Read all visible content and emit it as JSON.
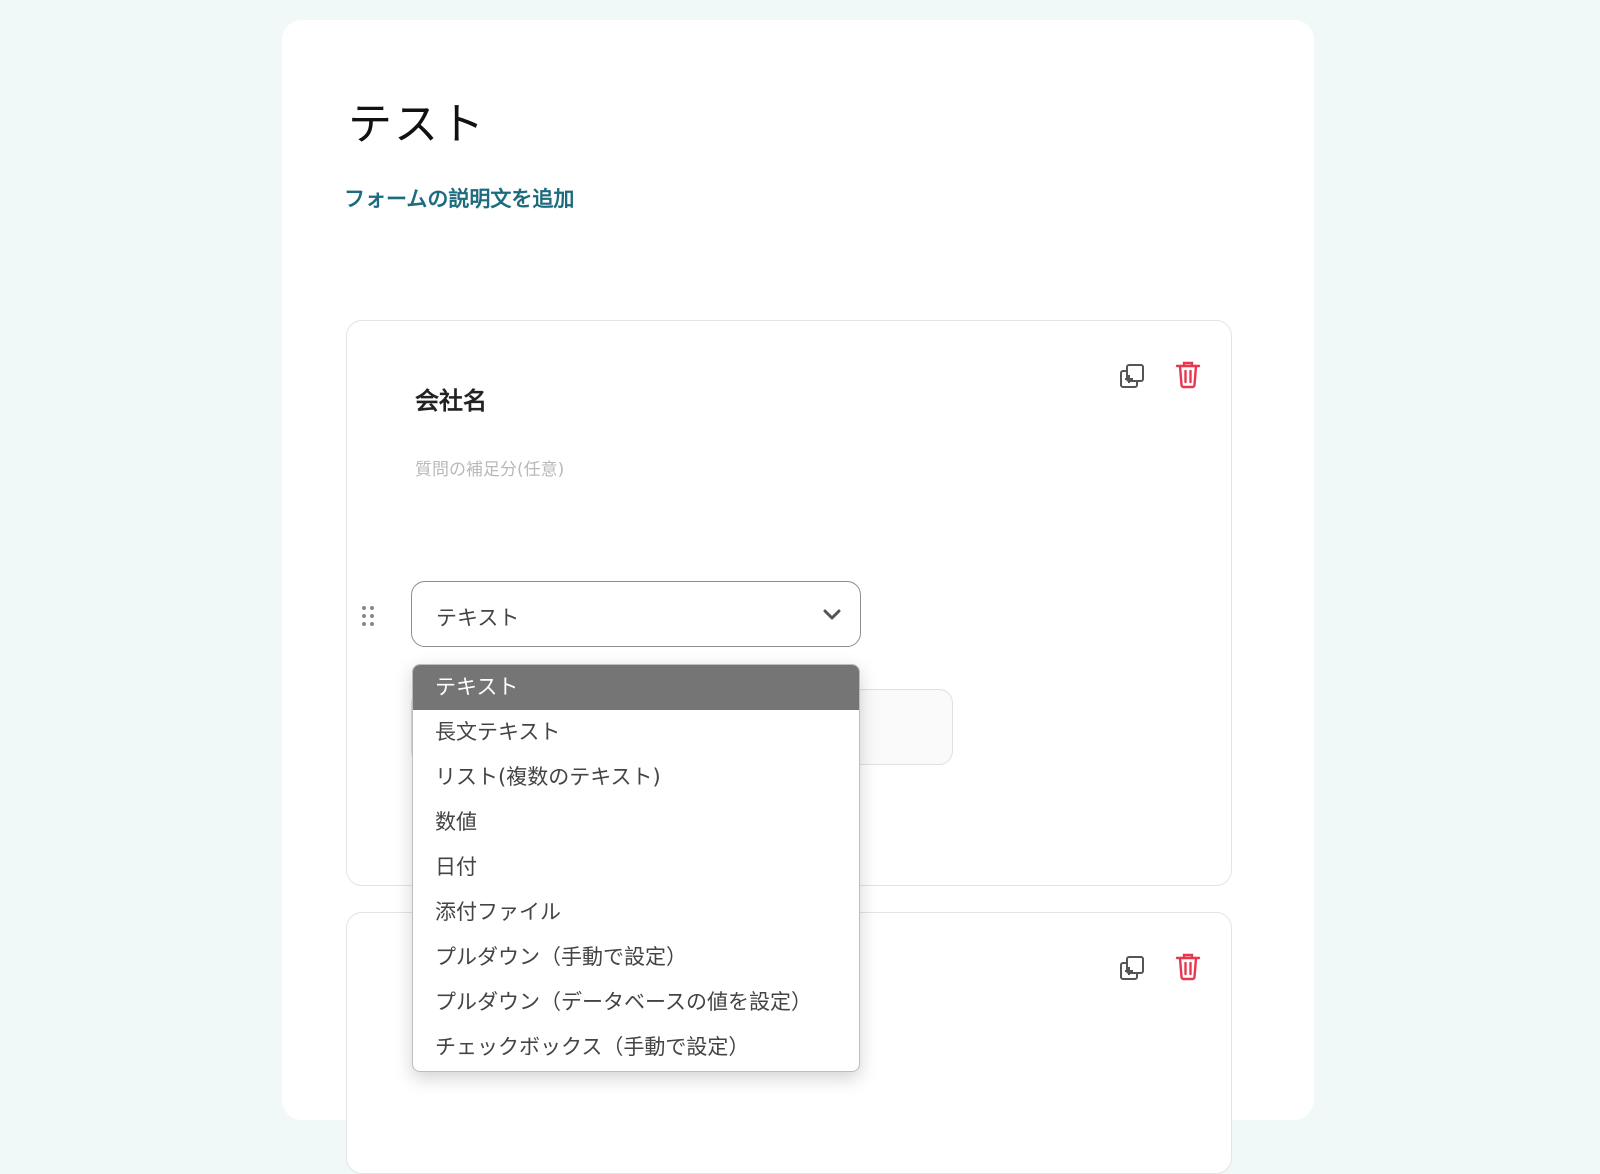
{
  "form": {
    "title": "テスト",
    "add_description_link": "フォームの説明文を追加"
  },
  "question1": {
    "title": "会社名",
    "hint_placeholder": "質問の補足分(任意)",
    "type_select": {
      "selected": "テキスト"
    }
  },
  "dropdown": {
    "options": [
      "テキスト",
      "長文テキスト",
      "リスト(複数のテキスト)",
      "数値",
      "日付",
      "添付ファイル",
      "プルダウン（手動で設定）",
      "プルダウン（データベースの値を設定）",
      "チェックボックス（手動で設定）"
    ],
    "selected_index": 0
  },
  "colors": {
    "background": "#f1f9f8",
    "link": "#1d6b7e",
    "delete_icon": "#e8384f",
    "selected_option_bg": "#757575"
  },
  "icons": {
    "copy": "copy-add-icon",
    "delete": "trash-icon",
    "drag": "drag-handle-icon",
    "chevron": "chevron-down-icon"
  }
}
